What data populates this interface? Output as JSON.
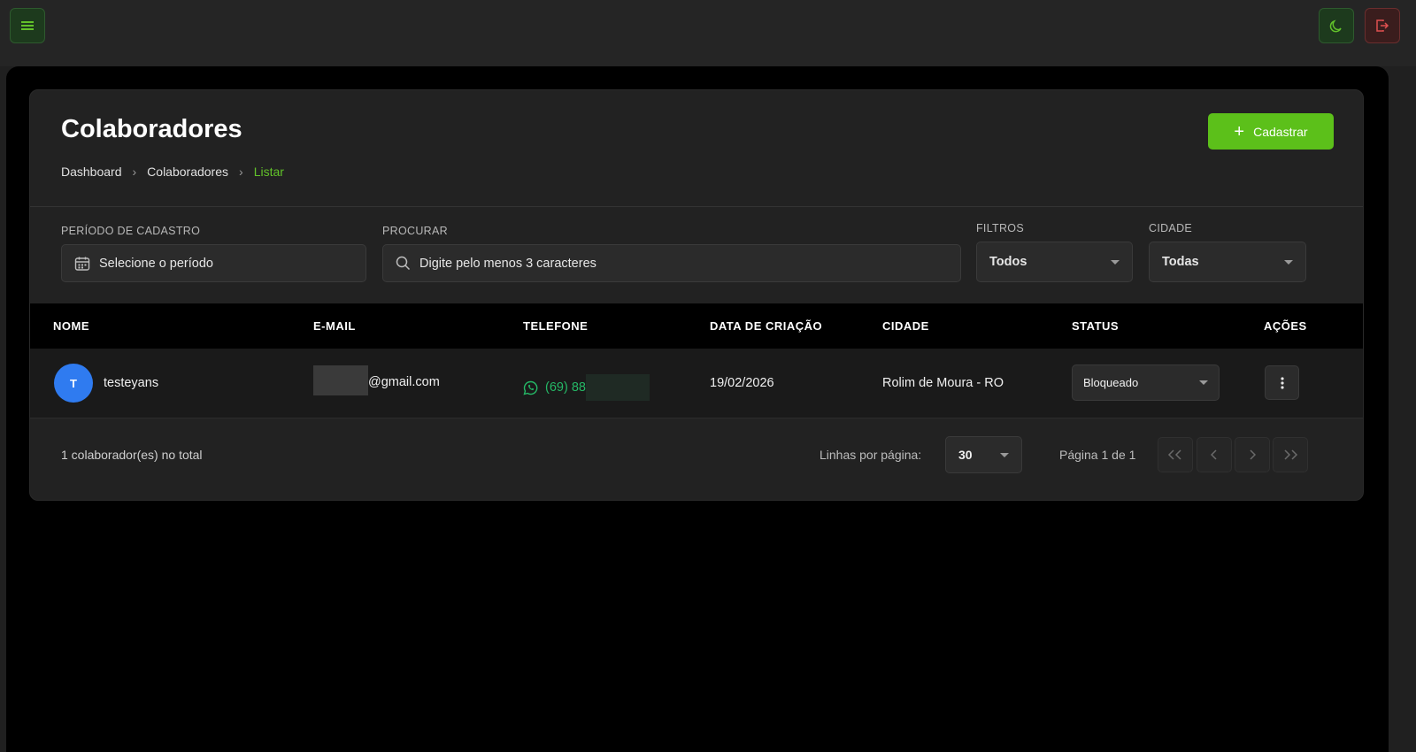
{
  "page": {
    "title": "Colaboradores",
    "breadcrumb": [
      "Dashboard",
      "Colaboradores",
      "Listar"
    ],
    "add_button": "Cadastrar"
  },
  "filters": {
    "period_label": "PERÍODO DE CADASTRO",
    "period_placeholder": "Selecione o período",
    "search_label": "PROCURAR",
    "search_placeholder": "Digite pelo menos 3 caracteres",
    "filter_label": "FILTROS",
    "filter_value": "Todos",
    "city_label": "CIDADE",
    "city_value": "Todas"
  },
  "table": {
    "headers": [
      "NOME",
      "E-MAIL",
      "TELEFONE",
      "DATA DE CRIAÇÃO",
      "CIDADE",
      "STATUS",
      "AÇÕES"
    ],
    "rows": [
      {
        "initial": "T",
        "name": "testeyans",
        "email": "@gmail.com",
        "phone": "(69) 88",
        "created": "19/02/2026",
        "city": "Rolim de Moura - RO",
        "status": "Bloqueado"
      }
    ]
  },
  "footer": {
    "total": "1 colaborador(es) no total",
    "rows_per_page_label": "Linhas por página:",
    "rows_per_page": "30",
    "page_info": "Página 1 de 1"
  },
  "colors": {
    "accent": "#5cc01a",
    "avatar": "#2f7bf0",
    "whatsapp": "#25b866",
    "danger": "#d9534f"
  }
}
